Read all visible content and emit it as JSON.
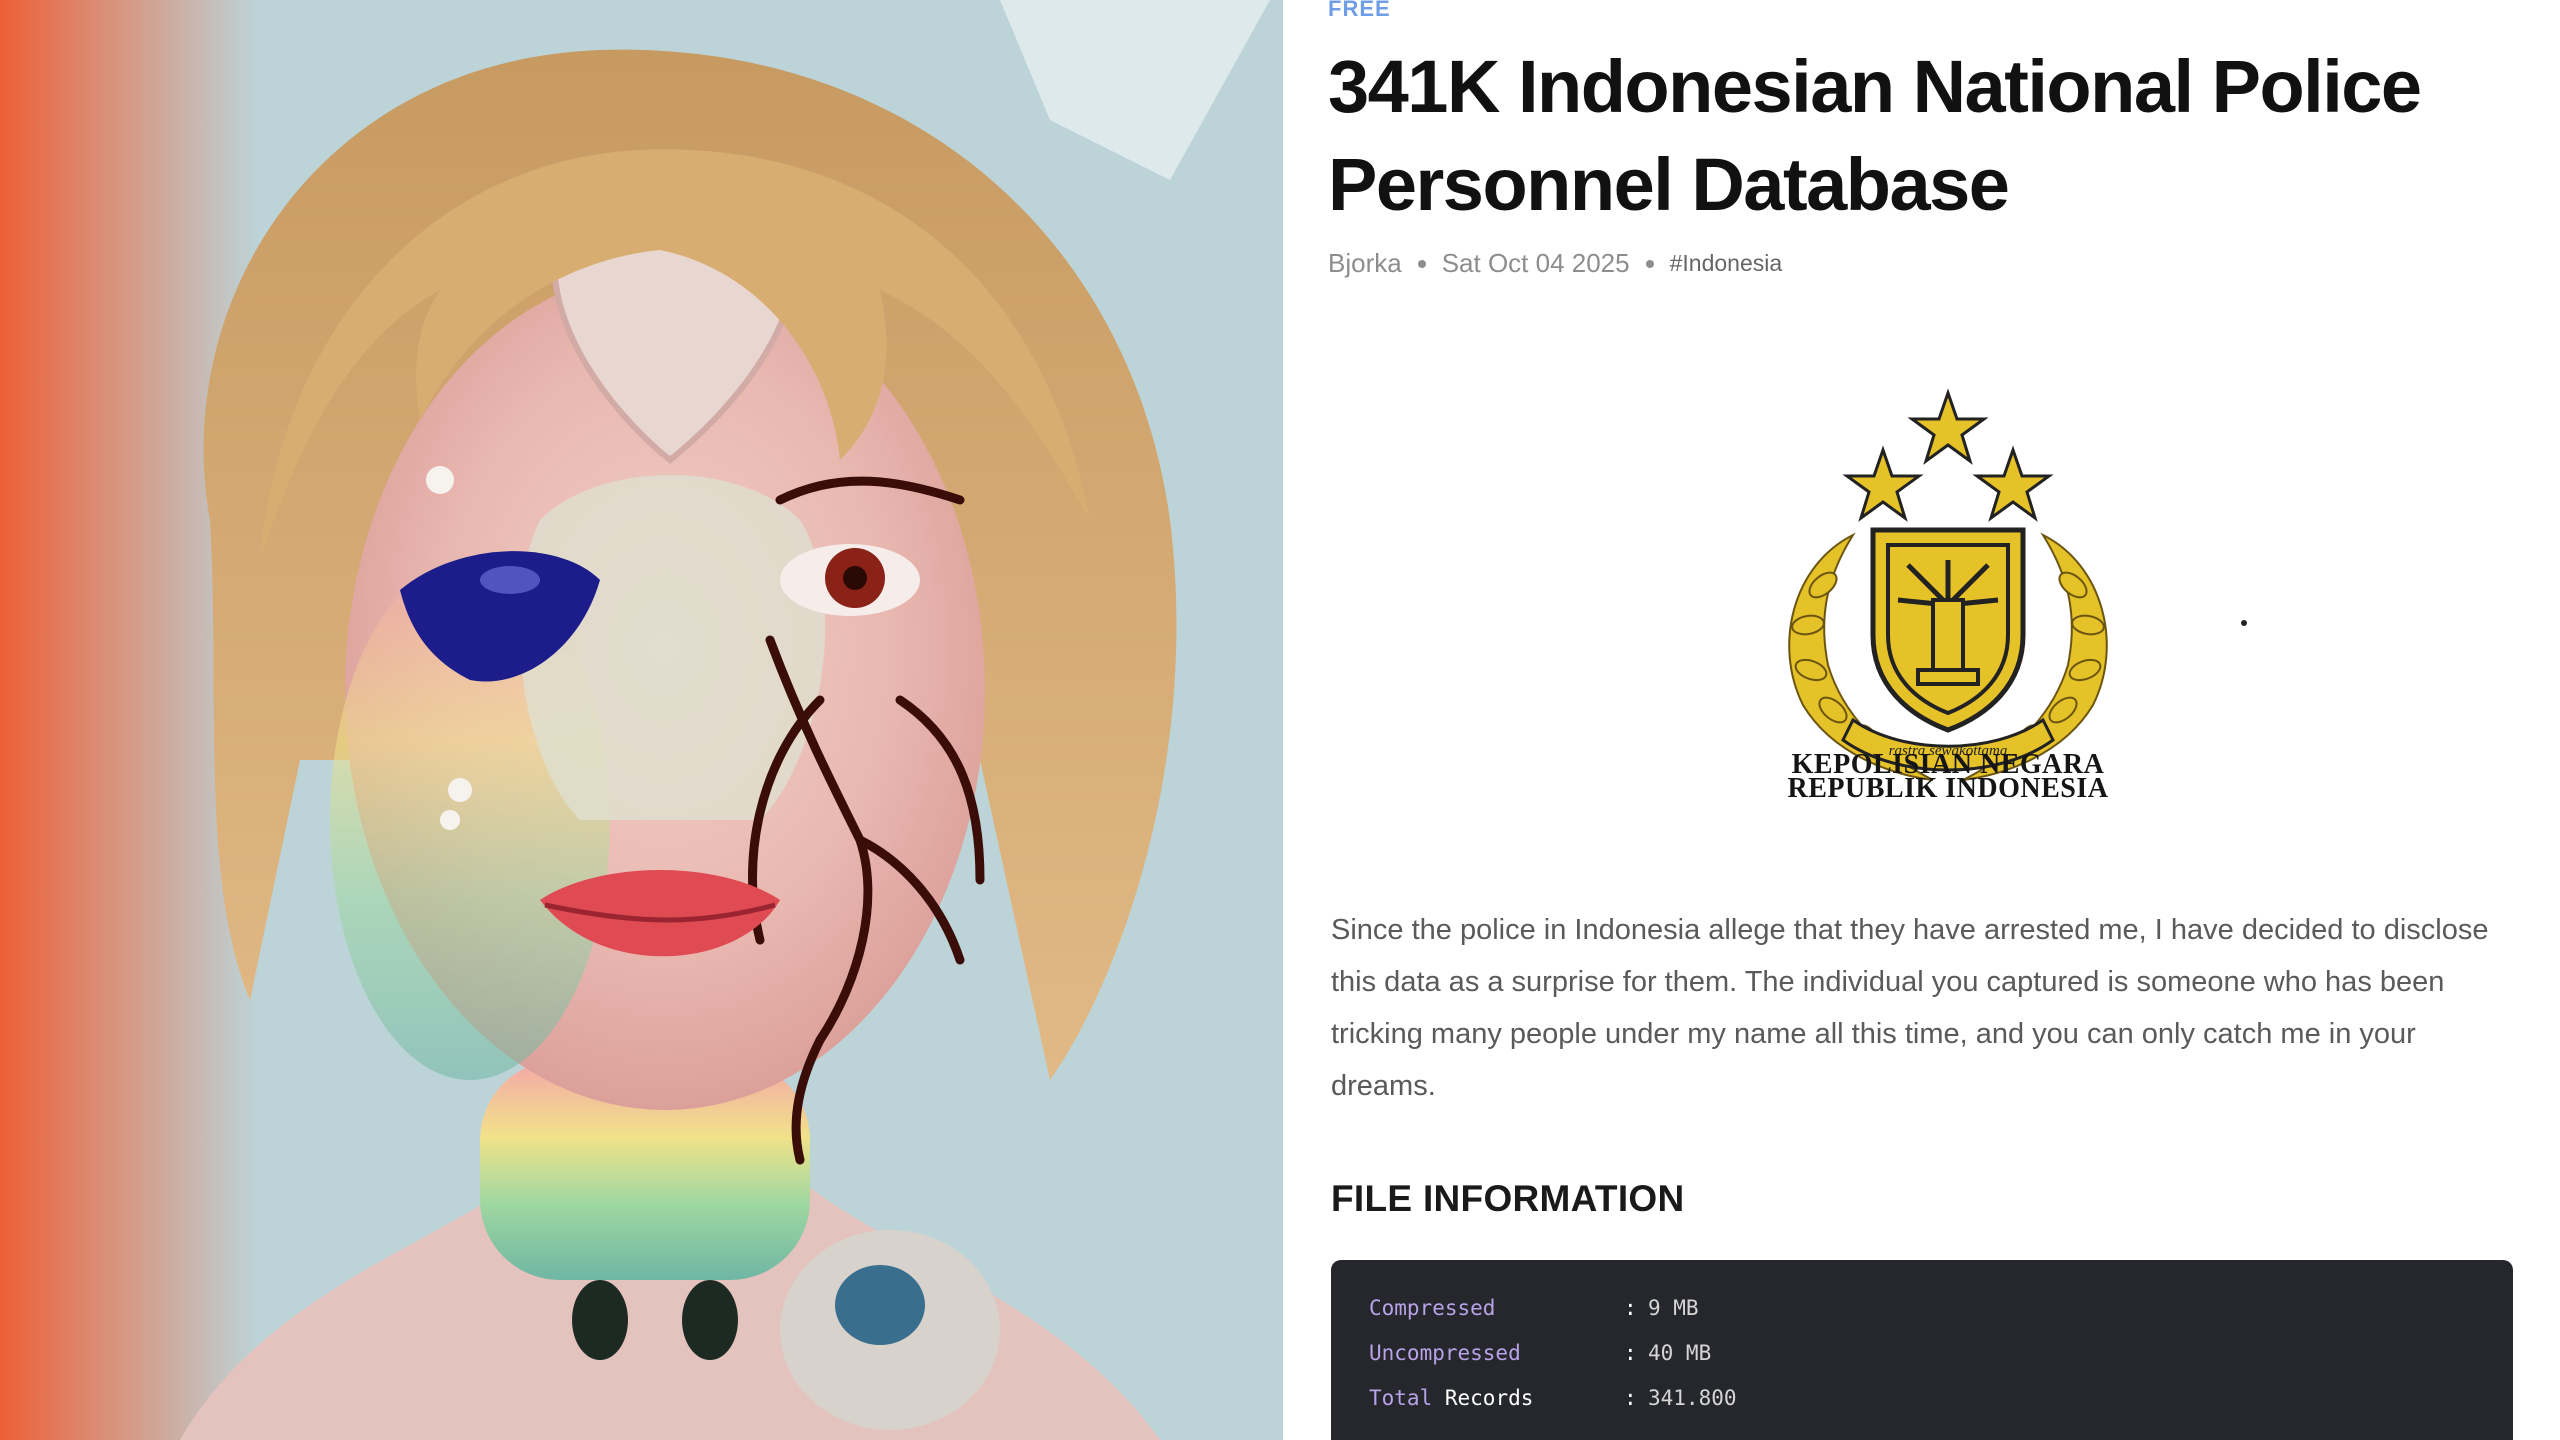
{
  "article": {
    "tier": "FREE",
    "title": "341K Indonesian National Police Personnel Database",
    "author": "Bjorka",
    "date": "Sat Oct 04 2025",
    "tag": "#Indonesia",
    "emblem": {
      "motto": "rastra sewakottama",
      "line1": "KEPOLISIAN NEGARA",
      "line2": "REPUBLIK INDONESIA"
    },
    "body": "Since the police in Indonesia allege that they have arrested me, I have decided to disclose this data as a surprise for them. The individual you captured is someone who has been tricking many people under my name all this time, and you can only catch me in your dreams.",
    "file_info": {
      "heading": "FILE INFORMATION",
      "rows": [
        {
          "key": "Compressed",
          "sep": ":",
          "value": "9 MB"
        },
        {
          "key": "Uncompressed",
          "sep": ":",
          "value": "40 MB"
        },
        {
          "key_a": "Total",
          "key_b": "Records",
          "sep": ":",
          "value": "341.800"
        }
      ]
    }
  },
  "colors": {
    "badge": "#6f9ee6",
    "code_bg": "#25272c",
    "code_key": "#b8a2e8",
    "emblem_gold": "#e6c229"
  },
  "icons": [
    "star-icon",
    "police-emblem-icon"
  ]
}
